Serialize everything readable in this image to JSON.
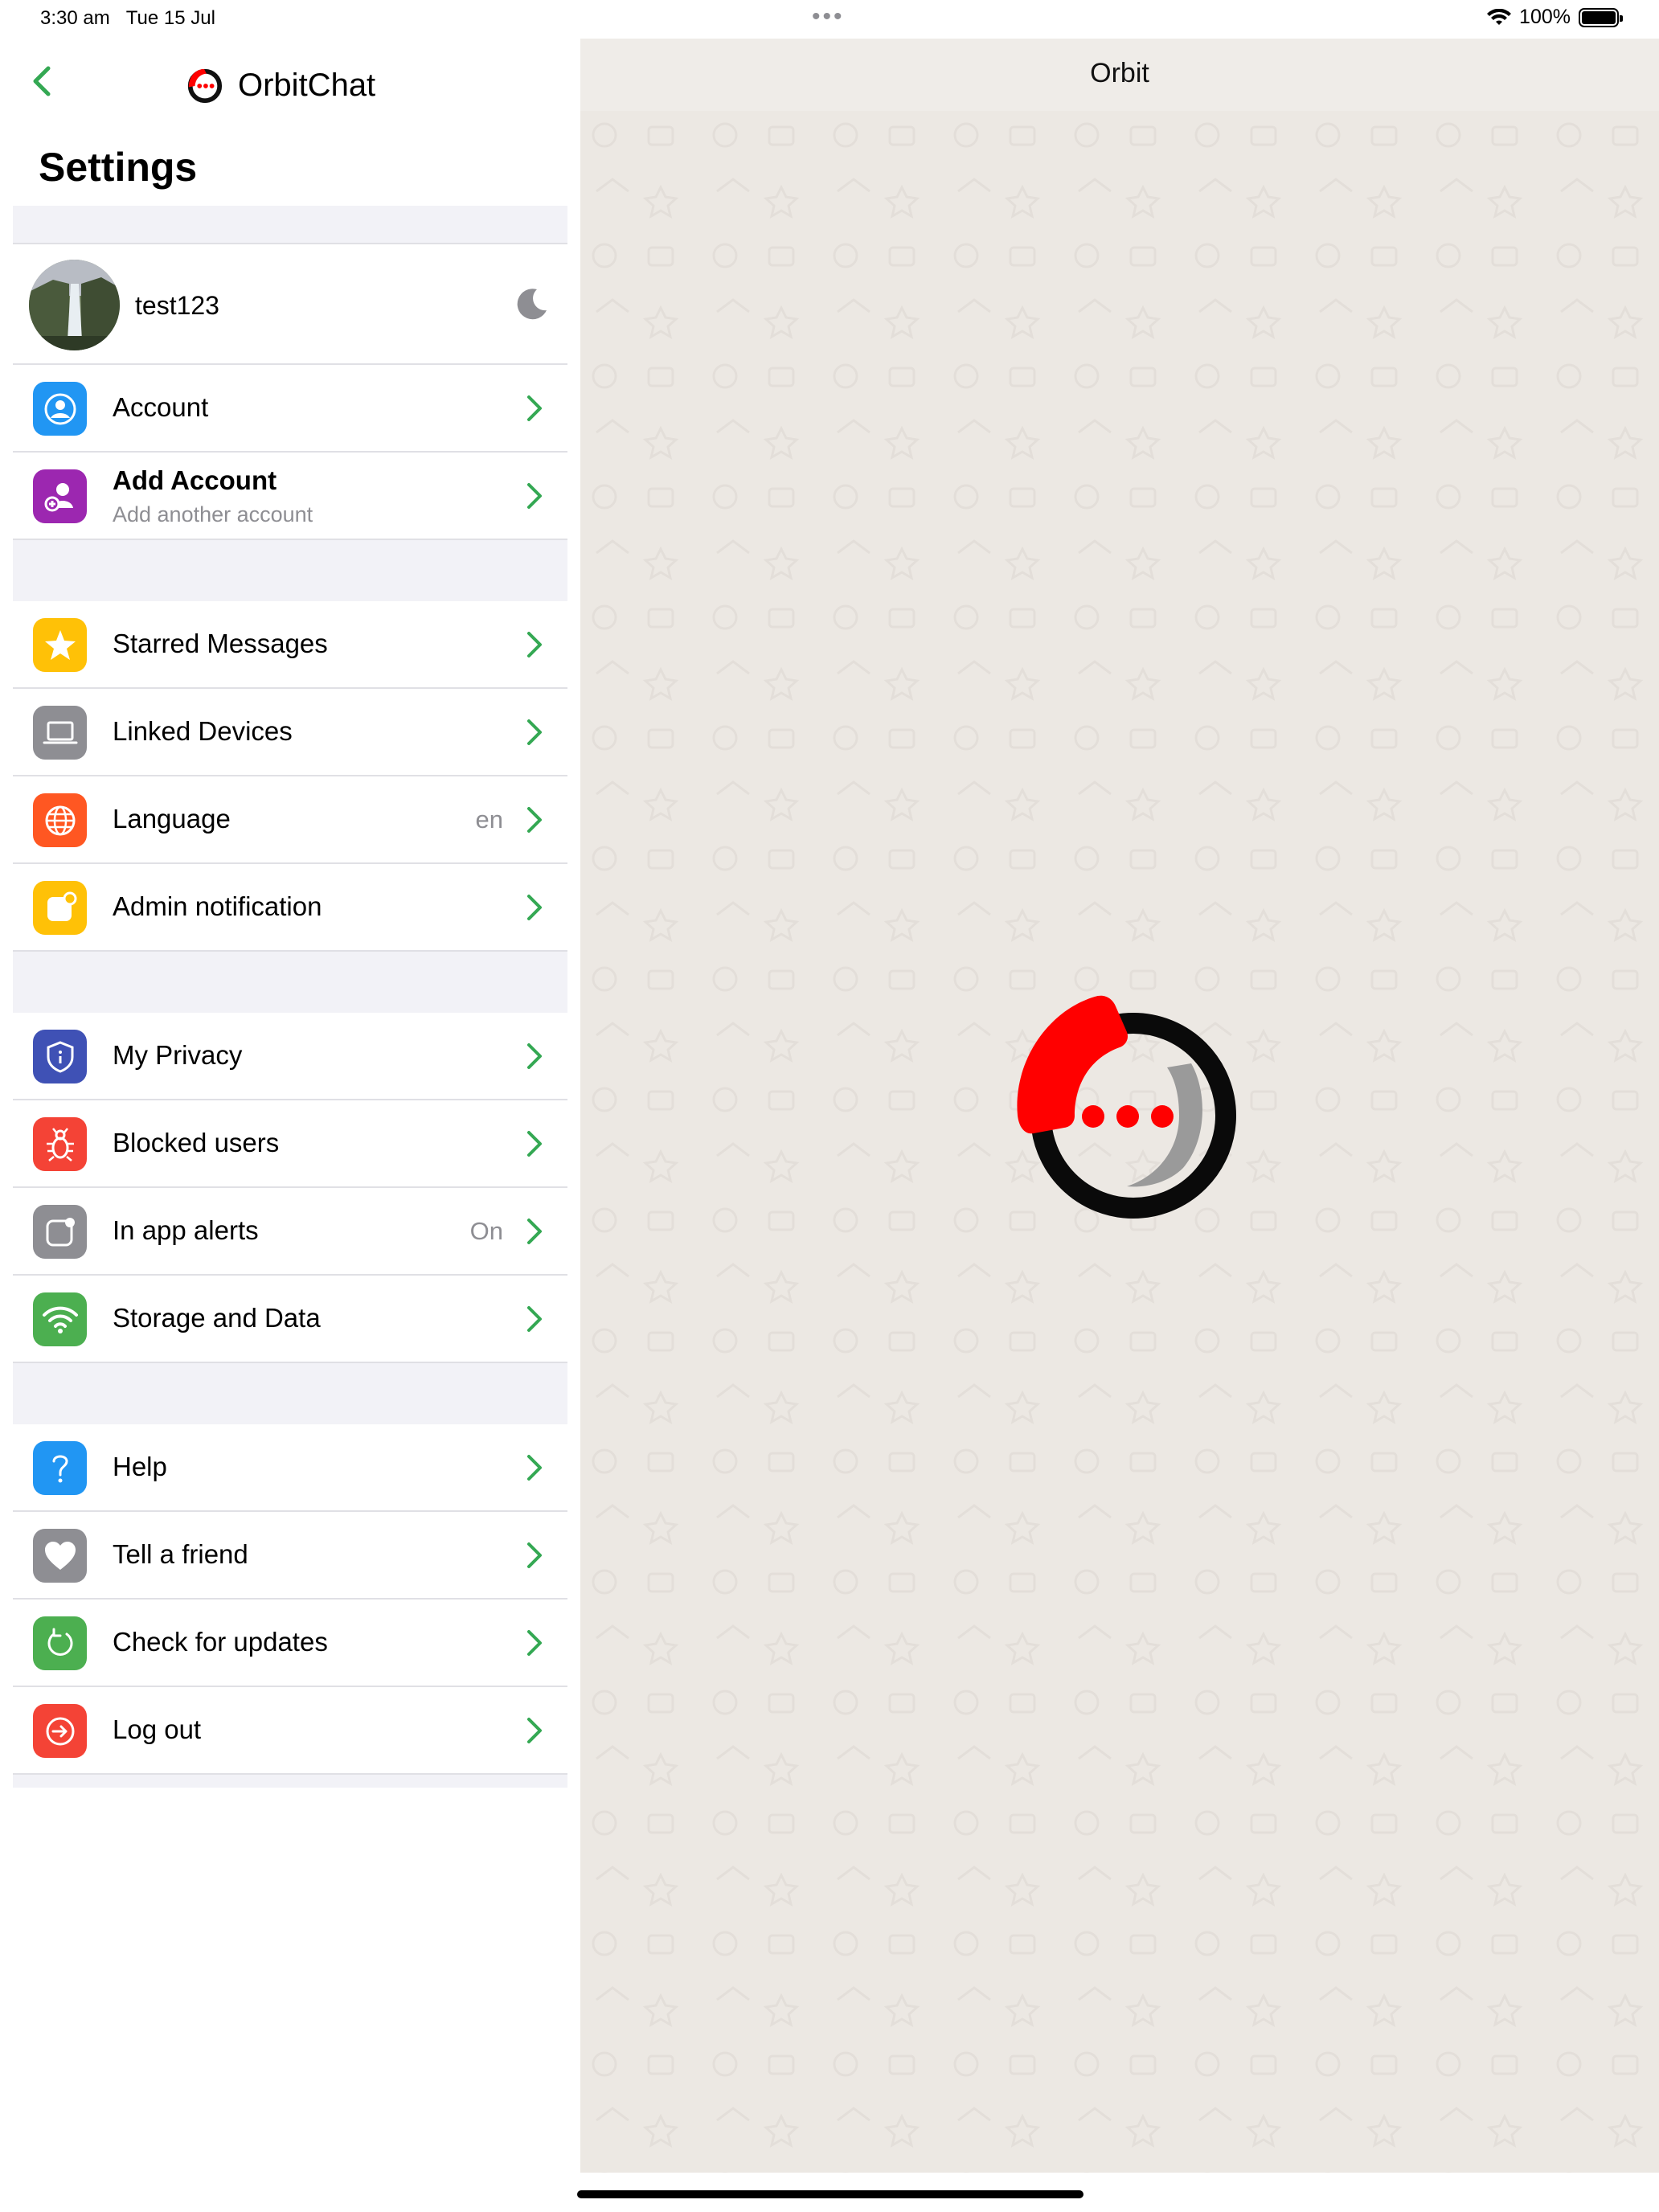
{
  "status_bar": {
    "time": "3:30 am",
    "date": "Tue 15 Jul",
    "dots": "•••",
    "battery": "100%"
  },
  "nav": {
    "app_name": "OrbitChat",
    "title": "Settings"
  },
  "profile": {
    "username": "test123"
  },
  "menu": {
    "account": {
      "label": "Account"
    },
    "add_account": {
      "label": "Add Account",
      "subtitle": "Add another account"
    },
    "starred": {
      "label": "Starred Messages"
    },
    "linked": {
      "label": "Linked Devices"
    },
    "language": {
      "label": "Language",
      "value": "en"
    },
    "admin": {
      "label": "Admin notification"
    },
    "privacy": {
      "label": "My Privacy"
    },
    "blocked": {
      "label": "Blocked users"
    },
    "alerts": {
      "label": "In app alerts",
      "value": "On"
    },
    "storage": {
      "label": "Storage and Data"
    },
    "help": {
      "label": "Help"
    },
    "tell": {
      "label": "Tell a friend"
    },
    "updates": {
      "label": "Check for updates"
    },
    "logout": {
      "label": "Log out"
    }
  },
  "detail": {
    "title": "Orbit"
  },
  "colors": {
    "accent": "#34a853",
    "account": "#2196f3",
    "add_account": "#9c27b0",
    "starred": "#ffc107",
    "linked": "#8e8e93",
    "language": "#ff5722",
    "admin": "#ffc107",
    "privacy": "#3f51b5",
    "blocked": "#f44336",
    "alerts": "#8e8e93",
    "storage": "#4caf50",
    "help": "#2196f3",
    "tell": "#8e8e93",
    "updates": "#4caf50",
    "logout": "#f44336",
    "logo_red": "#ff0000"
  },
  "icons": [
    "chevron-left-icon",
    "moon-icon",
    "person-circle-icon",
    "person-add-icon",
    "star-icon",
    "laptop-icon",
    "globe-icon",
    "notification-icon",
    "shield-icon",
    "bug-icon",
    "alert-icon",
    "wifi-icon",
    "question-icon",
    "heart-icon",
    "refresh-icon",
    "logout-icon",
    "chevron-right-icon"
  ]
}
